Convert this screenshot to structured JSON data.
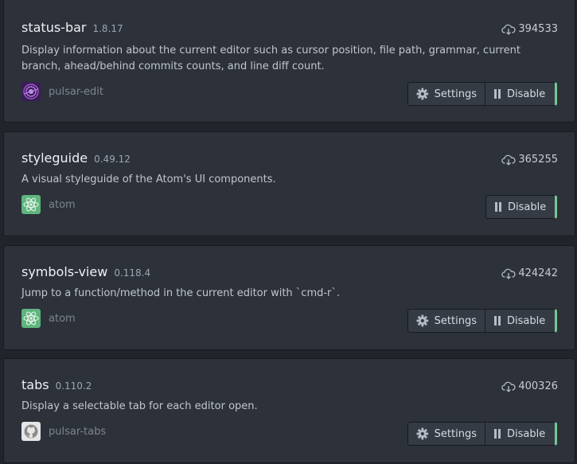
{
  "packages": [
    {
      "name": "status-bar",
      "version": "1.8.17",
      "description": "Display information about the current editor such as cursor position, file path, grammar, current branch, ahead/behind commits counts, and line diff count.",
      "owner": "pulsar-edit",
      "owner_avatar_icon": "pulsar-logo-icon",
      "downloads": "394533",
      "settings_label": "Settings",
      "disable_label": "Disable"
    },
    {
      "name": "styleguide",
      "version": "0.49.12",
      "description": "A visual styleguide of the Atom's UI components.",
      "owner": "atom",
      "owner_avatar_icon": "atom-logo-icon",
      "downloads": "365255",
      "disable_label": "Disable"
    },
    {
      "name": "symbols-view",
      "version": "0.118.4",
      "description": "Jump to a function/method in the current editor with `cmd-r`.",
      "owner": "atom",
      "owner_avatar_icon": "atom-logo-icon",
      "downloads": "424242",
      "settings_label": "Settings",
      "disable_label": "Disable"
    },
    {
      "name": "tabs",
      "version": "0.110.2",
      "description": "Display a selectable tab for each editor open.",
      "owner": "pulsar-tabs",
      "owner_avatar_icon": "github-logo-icon",
      "downloads": "400326",
      "settings_label": "Settings",
      "disable_label": "Disable"
    }
  ],
  "colors": {
    "card_background": "#2c313a",
    "page_background": "#21252b",
    "enabled_accent": "#73c990",
    "atom_avatar": "#5fb57d",
    "pulsar_avatar": "#662d91"
  }
}
